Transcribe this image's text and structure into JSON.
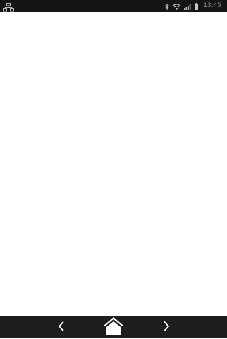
{
  "status_bar": {
    "left_icon": "network-icon",
    "right_icons": [
      "bluetooth-icon",
      "wifi-icon",
      "signal-icon",
      "battery-icon"
    ],
    "time": "13:45",
    "background_color": "#151515"
  },
  "content": {
    "background_color": "#ffffff"
  },
  "navigation_bar": {
    "buttons": [
      "back-icon",
      "home-icon",
      "forward-icon"
    ],
    "background_color": "#1e1e1e",
    "icon_color": "#ffffff"
  }
}
